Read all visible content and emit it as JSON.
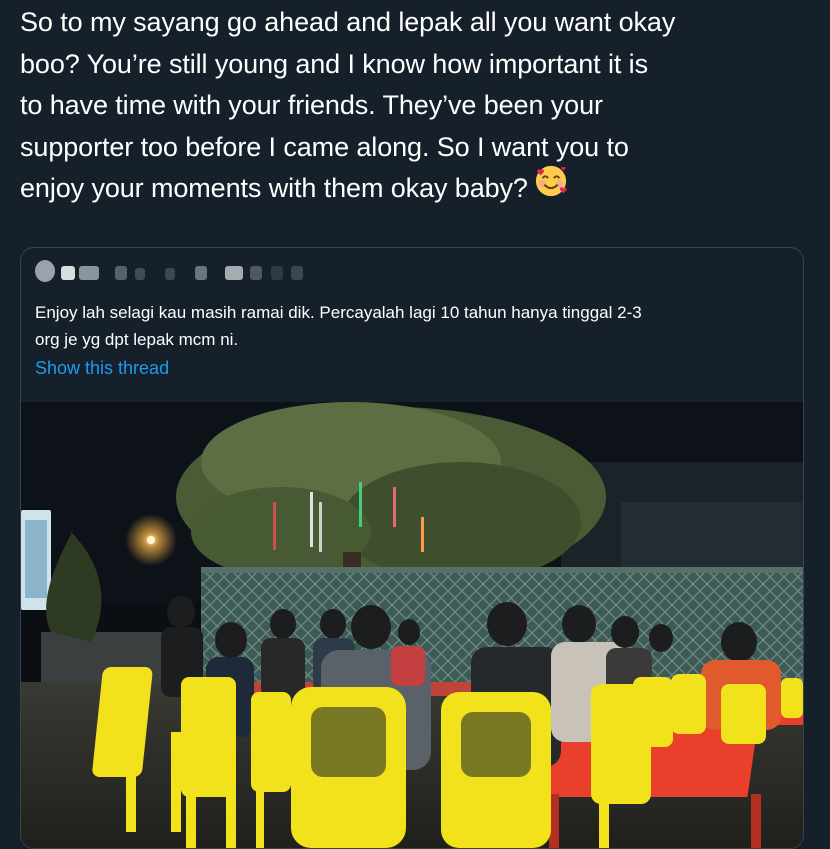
{
  "tweet": {
    "lines": [
      "So to my sayang go ahead and lepak all you want okay",
      "boo? You’re still young and I know how important it is",
      "to have time with your friends. They’ve been your",
      "supporter too before I came along. So I want you to",
      "enjoy your moments with them okay baby?"
    ],
    "emoji": "smiling-face-with-hearts-icon"
  },
  "quote": {
    "text_lines": [
      "Enjoy lah selagi kau masih ramai dik. Percayalah lagi 10 tahun hanya tinggal 2-3",
      "org je yg dpt lepak mcm ni."
    ],
    "show_thread": "Show this thread"
  },
  "colors": {
    "background": "#15202b",
    "border": "#38444d",
    "link": "#1d9bf0",
    "chair": "#f2e21b",
    "table": "#e8402c"
  }
}
